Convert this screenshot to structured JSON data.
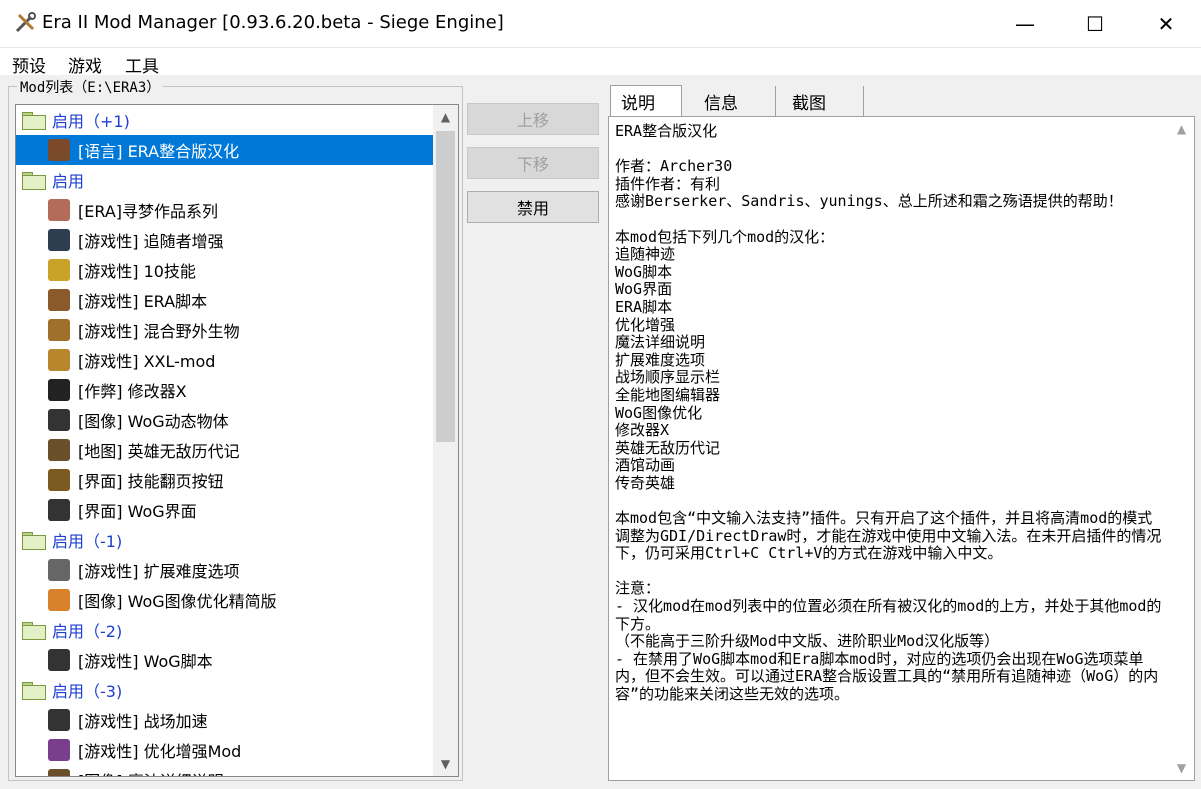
{
  "window": {
    "title": "Era II Mod Manager [0.93.6.20.beta - Siege Engine]",
    "minimize": "—",
    "maximize": "☐",
    "close": "✕"
  },
  "menu": [
    "预设",
    "游戏",
    "工具"
  ],
  "mod_list": {
    "caption": "Mod列表（E:\\ERA3）",
    "rows": [
      {
        "kind": "group",
        "label": "启用（+1)"
      },
      {
        "kind": "mod",
        "label": "[语言] ERA整合版汉化",
        "icon": "language-icon",
        "color": "#7a4a2a",
        "selected": true
      },
      {
        "kind": "group",
        "label": "启用"
      },
      {
        "kind": "mod",
        "label": "[ERA]寻梦作品系列",
        "icon": "portrait-icon",
        "color": "#b36b5a"
      },
      {
        "kind": "mod",
        "label": "[游戏性] 追随者增强",
        "icon": "figure-icon",
        "color": "#2c3e50"
      },
      {
        "kind": "mod",
        "label": "[游戏性] 10技能",
        "icon": "scroll-icon",
        "color": "#c9a227"
      },
      {
        "kind": "mod",
        "label": "[游戏性] ERA脚本",
        "icon": "rune-icon",
        "color": "#8b5a2b"
      },
      {
        "kind": "mod",
        "label": "[游戏性] 混合野外生物",
        "icon": "creature-icon",
        "color": "#a0702a"
      },
      {
        "kind": "mod",
        "label": "[游戏性] XXL-mod",
        "icon": "frame-icon",
        "color": "#b8862b"
      },
      {
        "kind": "mod",
        "label": "[作弊] 修改器X",
        "icon": "skull-icon",
        "color": "#222222"
      },
      {
        "kind": "mod",
        "label": "[图像] WoG动态物体",
        "icon": "wog-icon",
        "color": "#333333"
      },
      {
        "kind": "mod",
        "label": "[地图] 英雄无敌历代记",
        "icon": "book-icon",
        "color": "#6b4e2a"
      },
      {
        "kind": "mod",
        "label": "[界面] 技能翻页按钮",
        "icon": "button-icon",
        "color": "#7a5a20"
      },
      {
        "kind": "mod",
        "label": "[界面] WoG界面",
        "icon": "wog-icon",
        "color": "#333333"
      },
      {
        "kind": "group",
        "label": "启用（-1)"
      },
      {
        "kind": "mod",
        "label": "[游戏性] 扩展难度选项",
        "icon": "knight-icon",
        "color": "#666666"
      },
      {
        "kind": "mod",
        "label": "[图像] WoG图像优化精简版",
        "icon": "fire-icon",
        "color": "#d9822b"
      },
      {
        "kind": "group",
        "label": "启用（-2)"
      },
      {
        "kind": "mod",
        "label": "[游戏性] WoG脚本",
        "icon": "wog-icon",
        "color": "#333333"
      },
      {
        "kind": "group",
        "label": "启用（-3)"
      },
      {
        "kind": "mod",
        "label": "[游戏性] 战场加速",
        "icon": "runner-icon",
        "color": "#333333"
      },
      {
        "kind": "mod",
        "label": "[游戏性] 优化增强Mod",
        "icon": "gems-icon",
        "color": "#7a3f8c"
      },
      {
        "kind": "mod",
        "label": "[图像] 魔法详细说明",
        "icon": "book-icon",
        "color": "#6b4e2a"
      }
    ]
  },
  "buttons": {
    "move_up": "上移",
    "move_down": "下移",
    "disable": "禁用"
  },
  "tabs": [
    "说明",
    "信息",
    "截图"
  ],
  "description": "ERA整合版汉化\n\n作者：Archer30\n插件作者：有利\n感谢Berserker、Sandris、yunings、总上所述和霜之殇语提供的帮助！\n\n本mod包括下列几个mod的汉化：\n追随神迹\nWoG脚本\nWoG界面\nERA脚本\n优化增强\n魔法详细说明\n扩展难度选项\n战场顺序显示栏\n全能地图编辑器\nWoG图像优化\n修改器X\n英雄无敌历代记\n酒馆动画\n传奇英雄\n\n本mod包含“中文输入法支持”插件。只有开启了这个插件，并且将高清mod的模式调整为GDI/DirectDraw时，才能在游戏中使用中文输入法。在未开启插件的情况下，仍可采用Ctrl+C Ctrl+V的方式在游戏中输入中文。\n\n注意：\n- 汉化mod在mod列表中的位置必须在所有被汉化的mod的上方，并处于其他mod的下方。\n（不能高于三阶升级Mod中文版、进阶职业Mod汉化版等）\n- 在禁用了WoG脚本mod和Era脚本mod时，对应的选项仍会出现在WoG选项菜单内，但不会生效。可以通过ERA整合版设置工具的“禁用所有追随神迹（WoG）的内容”的功能来关闭这些无效的选项。"
}
